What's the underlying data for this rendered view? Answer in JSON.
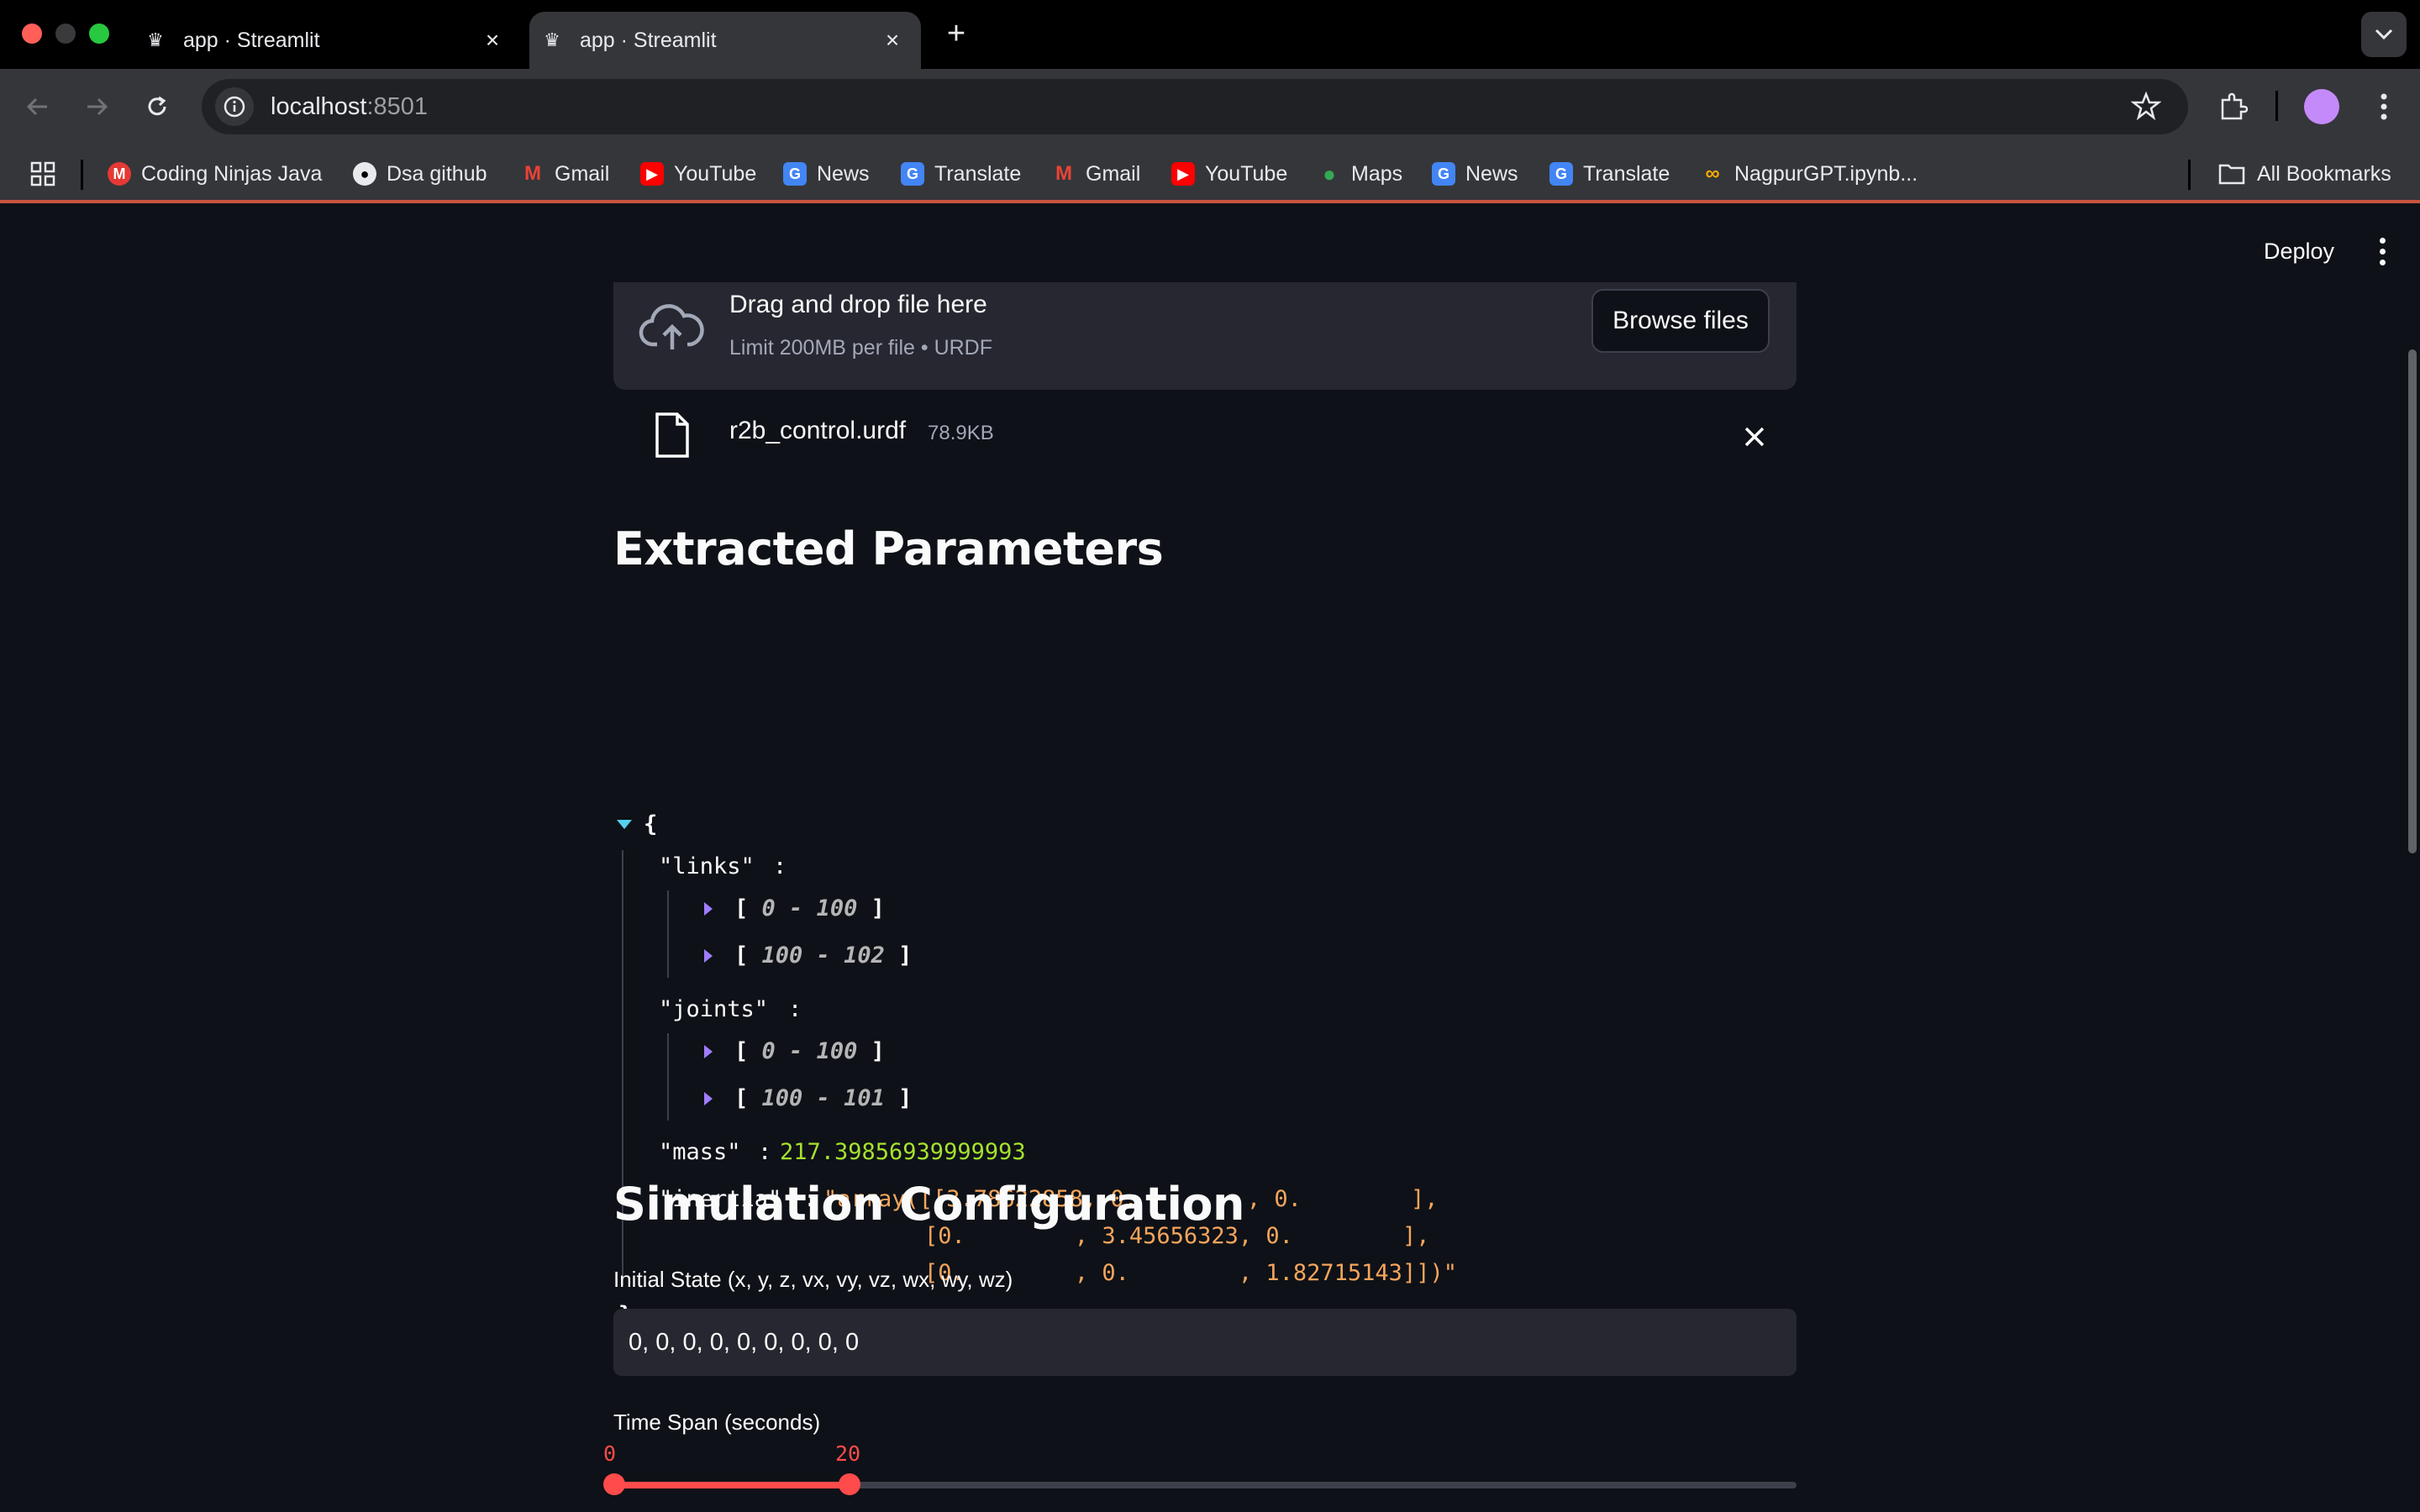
{
  "browser": {
    "tabs": [
      {
        "title": "app · Streamlit",
        "active": false
      },
      {
        "title": "app · Streamlit",
        "active": true
      }
    ],
    "url": {
      "host": "localhost",
      "port": ":8501"
    },
    "bookmarks": [
      {
        "label": "Coding Ninjas Java",
        "icon": "coding-ninjas-icon"
      },
      {
        "label": "Dsa github",
        "icon": "github-icon"
      },
      {
        "label": "Gmail",
        "icon": "gmail-icon"
      },
      {
        "label": "YouTube",
        "icon": "youtube-icon"
      },
      {
        "label": "News",
        "icon": "google-news-icon"
      },
      {
        "label": "Translate",
        "icon": "google-translate-icon"
      },
      {
        "label": "Gmail",
        "icon": "gmail-icon"
      },
      {
        "label": "YouTube",
        "icon": "youtube-icon"
      },
      {
        "label": "Maps",
        "icon": "google-maps-icon"
      },
      {
        "label": "News",
        "icon": "google-news-icon"
      },
      {
        "label": "Translate",
        "icon": "google-translate-icon"
      },
      {
        "label": "NagpurGPT.ipynb...",
        "icon": "colab-icon"
      }
    ],
    "all_bookmarks": "All Bookmarks"
  },
  "app": {
    "deploy_label": "Deploy",
    "uploader": {
      "title": "Drag and drop file here",
      "subtitle": "Limit 200MB per file • URDF",
      "browse_label": "Browse files"
    },
    "uploaded_file": {
      "name": "r2b_control.urdf",
      "size": "78.9KB"
    },
    "extracted_heading": "Extracted Parameters",
    "json": {
      "open_brace": "{",
      "close_brace": "}",
      "links_key": "\"links\"",
      "links_ranges": [
        [
          "0",
          "100"
        ],
        [
          "100",
          "102"
        ]
      ],
      "joints_key": "\"joints\"",
      "joints_ranges": [
        [
          "0",
          "100"
        ],
        [
          "100",
          "101"
        ]
      ],
      "mass_key": "\"mass\"",
      "mass_value": "217.39856939999993",
      "inertia_key": "\"inertia\"",
      "inertia_lines": [
        "\"array([[3.78622858, 0.        , 0.        ],",
        "[0.        , 3.45656323, 0.        ],",
        "[0.        , 0.        , 1.82715143]])\""
      ],
      "colon": ":",
      "range_sep": " - "
    },
    "sim_heading": "Simulation Configuration",
    "initial_state": {
      "label": "Initial State (x, y, z, vx, vy, vz, wx, wy, wz)",
      "value": "0, 0, 0, 0, 0, 0, 0, 0, 0"
    },
    "time_span": {
      "label": "Time Span (seconds)",
      "low": "0",
      "high": "20"
    },
    "colors": {
      "accent": "#ff4b4b",
      "background": "#0e1117",
      "widget": "#262730"
    }
  }
}
